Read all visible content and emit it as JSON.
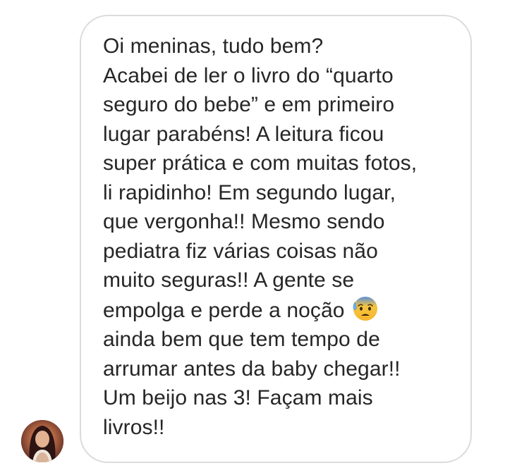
{
  "message": {
    "lines_before_emoji": "Oi meninas, tudo bem?\nAcabei de ler o livro do “quarto\nseguro do bebe” e em primeiro\nlugar parabéns! A leitura ficou\nsuper prática e com muitas fotos,\nli rapidinho! Em segundo lugar,\nque vergonha!! Mesmo sendo\npediatra fiz várias coisas não\nmuito seguras!! A gente se\nempolga e perde a noção ",
    "emoji_name": "anxious-face-with-sweat-icon",
    "lines_after_emoji": "\nainda bem que tem tempo de\narrumar antes da baby chegar!!\nUm beijo nas 3! Façam mais\nlivros!!"
  },
  "colors": {
    "text": "#262626",
    "bubble_border": "#dbdbdb",
    "background": "#ffffff"
  }
}
